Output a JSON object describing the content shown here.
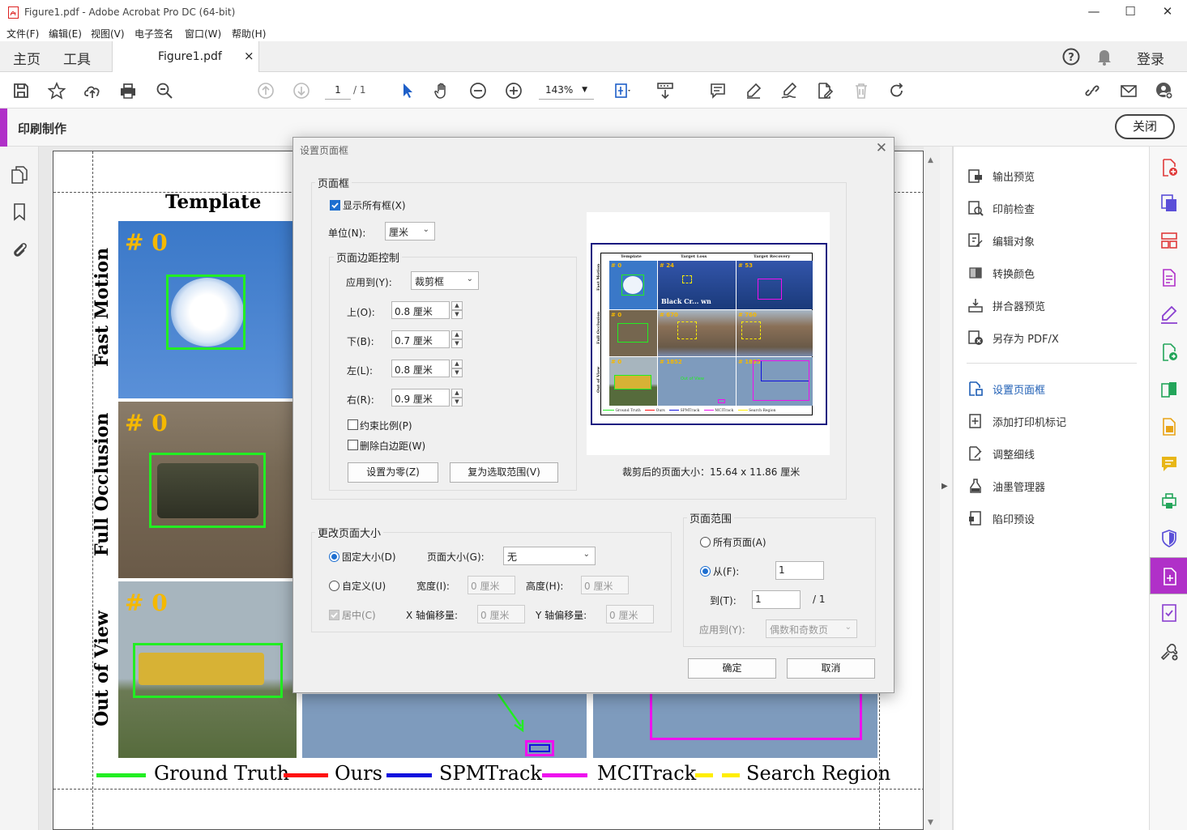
{
  "window": {
    "title": "Figure1.pdf - Adobe Acrobat Pro DC (64-bit)"
  },
  "menu": [
    "文件(F)",
    "编辑(E)",
    "视图(V)",
    "电子签名",
    "窗口(W)",
    "帮助(H)"
  ],
  "tabs": {
    "home": "主页",
    "tools": "工具",
    "doc": "Figure1.pdf",
    "close": "×",
    "login": "登录"
  },
  "toolbar": {
    "page_current": "1",
    "page_total": "/ 1",
    "zoom": "143%"
  },
  "printbar": {
    "label": "印刷制作",
    "close": "关闭"
  },
  "tool_panel": {
    "items": [
      "输出预览",
      "印前检查",
      "编辑对象",
      "转换颜色",
      "拼合器预览",
      "另存为 PDF/X",
      "设置页面框",
      "添加打印机标记",
      "调整细线",
      "油墨管理器",
      "陷印预设"
    ]
  },
  "figure": {
    "col_header": "Template",
    "rows": [
      "Fast Motion",
      "Full Occlusion",
      "Out of View"
    ],
    "frame_numbers": [
      "# 0",
      "# 0",
      "# 0"
    ],
    "legend": [
      "Ground Truth",
      "Ours",
      "SPMTrack",
      "MCITrack",
      "Search Region"
    ],
    "legend_colors": [
      "#22ee22",
      "#ff1111",
      "#1111dd",
      "#ee11ee",
      "#ffee00"
    ]
  },
  "dialog": {
    "title": "设置页面框",
    "page_box_group": "页面框",
    "show_all_boxes": "显示所有框(X)",
    "unit_label": "单位(N):",
    "unit_value": "厘米",
    "margin_group": "页面边距控制",
    "apply_to_label": "应用到(Y):",
    "apply_to_value": "裁剪框",
    "top_label": "上(O):",
    "top_value": "0.8 厘米",
    "bottom_label": "下(B):",
    "bottom_value": "0.7 厘米",
    "left_label": "左(L):",
    "left_value": "0.8 厘米",
    "right_label": "右(R):",
    "right_value": "0.9 厘米",
    "constrain": "约束比例(P)",
    "remove_white": "删除白边距(W)",
    "set_zero": "设置为零(Z)",
    "revert": "复为选取范围(V)",
    "cropped_size": "裁剪后的页面大小：15.64 x 11.86 厘米",
    "preview_headers": [
      "Template",
      "Target Loss",
      "Target Recovery"
    ],
    "preview_nums": [
      "# 0",
      "# 24",
      "# 53",
      "# 0",
      "# 670",
      "# 760",
      "# 0",
      "# 1852",
      "# 1895"
    ],
    "preview_rows": [
      "Fast Motion",
      "Full Occlusion",
      "Out of View"
    ],
    "preview_legend": [
      "Ground Truth",
      "Ours",
      "SPMTrack",
      "MCITrack",
      "Search Region"
    ],
    "preview_banner": "Black Cr... wn",
    "preview_note": "Out of View",
    "change_size_group": "更改页面大小",
    "fixed_size": "固定大小(D)",
    "page_size_label": "页面大小(G):",
    "page_size_value": "无",
    "custom": "自定义(U)",
    "width_label": "宽度(I):",
    "width_value": "0 厘米",
    "height_label": "高度(H):",
    "height_value": "0 厘米",
    "center": "居中(C)",
    "x_offset_label": "X 轴偏移量:",
    "x_offset_value": "0 厘米",
    "y_offset_label": "Y 轴偏移量:",
    "y_offset_value": "0 厘米",
    "range_group": "页面范围",
    "all_pages": "所有页面(A)",
    "from_label": "从(F):",
    "from_value": "1",
    "to_label": "到(T):",
    "to_value": "1",
    "to_total": "/ 1",
    "apply_label": "应用到(Y):",
    "apply_value": "偶数和奇数页",
    "ok": "确定",
    "cancel": "取消"
  }
}
